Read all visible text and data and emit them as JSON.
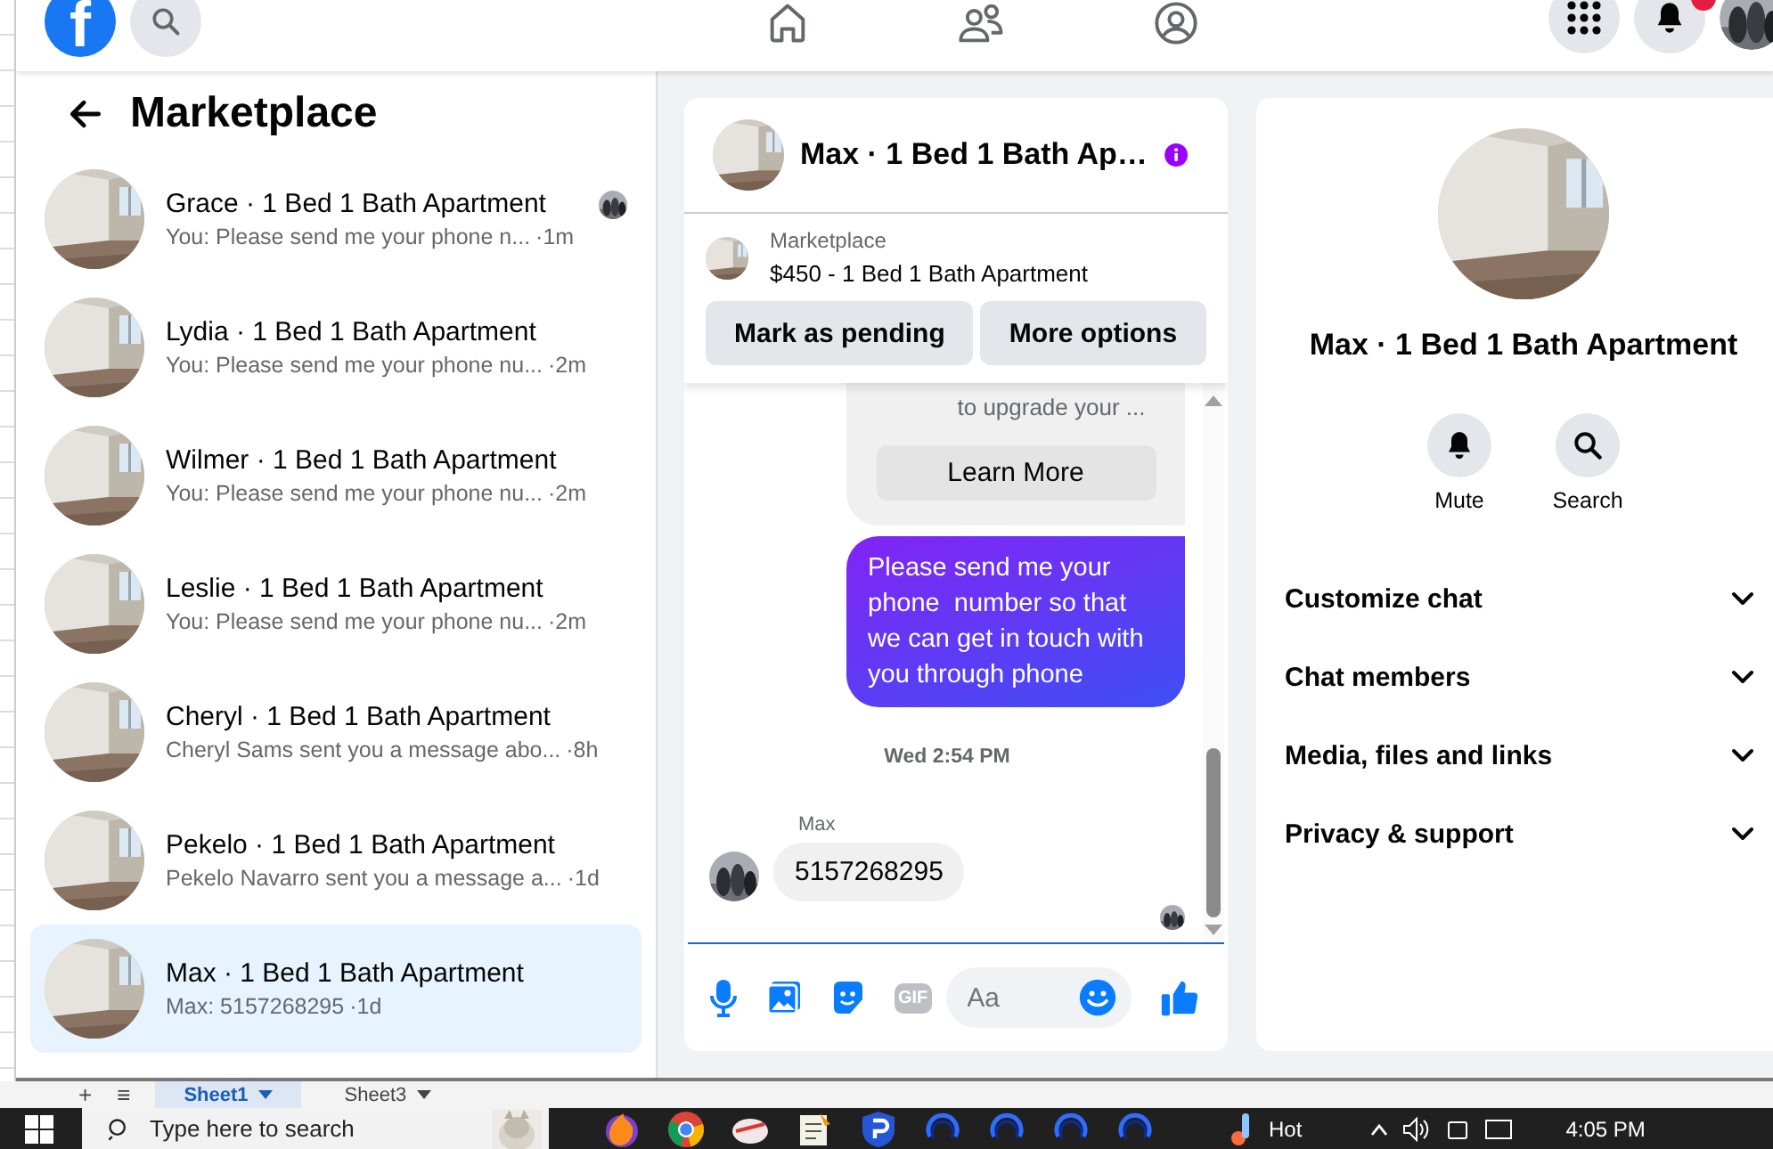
{
  "browser": {
    "logo": "f",
    "notifications_unread": true
  },
  "sidebar": {
    "title": "Marketplace",
    "conversations": [
      {
        "name": "Grace · 1 Bed 1 Bath Apartment",
        "preview": "You: Please send me your phone n...",
        "time": "·1m",
        "seen": true,
        "selected": false
      },
      {
        "name": "Lydia · 1 Bed 1 Bath Apartment",
        "preview": "You: Please send me your phone nu...",
        "time": "·2m",
        "seen": false,
        "selected": false
      },
      {
        "name": "Wilmer · 1 Bed 1 Bath Apartment",
        "preview": "You: Please send me your phone nu...",
        "time": "·2m",
        "seen": false,
        "selected": false
      },
      {
        "name": "Leslie · 1 Bed 1 Bath Apartment",
        "preview": "You: Please send me your phone nu...",
        "time": "·2m",
        "seen": false,
        "selected": false
      },
      {
        "name": "Cheryl · 1 Bed 1 Bath Apartment",
        "preview": "Cheryl Sams sent you a message abo...",
        "time": "·8h",
        "seen": false,
        "selected": false
      },
      {
        "name": "Pekelo · 1 Bed 1 Bath Apartment",
        "preview": "Pekelo Navarro sent you a message a...",
        "time": "·1d",
        "seen": false,
        "selected": false
      },
      {
        "name": "Max · 1 Bed 1 Bath Apartment",
        "preview": "Max: 5157268295",
        "time": "·1d",
        "seen": false,
        "selected": true
      }
    ]
  },
  "chat": {
    "title": "Max · 1 Bed 1 Bath Ap…",
    "listing": {
      "source": "Marketplace",
      "title": "$450 - 1 Bed 1 Bath Apartment",
      "buttons": [
        "Mark as pending",
        "More options"
      ]
    },
    "messages": [
      {
        "kind": "card",
        "text": "to upgrade your ...",
        "button": "Learn More"
      },
      {
        "kind": "outgoing",
        "text": "Please send me your phone  number so that we can get in touch with you through phone"
      },
      {
        "kind": "timestamp",
        "text": "Wed 2:54 PM"
      },
      {
        "kind": "incoming",
        "sender": "Max",
        "text": "5157268295",
        "seen": true
      }
    ],
    "composer": {
      "placeholder": "Aa",
      "gif": "GIF"
    }
  },
  "details": {
    "title": "Max · 1 Bed 1 Bath Apartment",
    "actions": [
      {
        "kind": "mute",
        "label": "Mute"
      },
      {
        "kind": "search",
        "label": "Search"
      }
    ],
    "sections": [
      {
        "label": "Customize chat",
        "expanded": false
      },
      {
        "label": "Chat members",
        "expanded": false
      },
      {
        "label": "Media, files and links",
        "expanded": false
      },
      {
        "label": "Privacy & support",
        "expanded": false
      }
    ]
  },
  "spreadsheet": {
    "add_symbol": "+",
    "menu_symbol": "≡",
    "sheet_tabs": [
      {
        "label": "Sheet1",
        "selected": true
      },
      {
        "label": "Sheet3",
        "selected": false
      }
    ]
  },
  "taskbar": {
    "search_placeholder": "Type here to search",
    "weather": "Hot",
    "clock": "4:05 PM"
  }
}
